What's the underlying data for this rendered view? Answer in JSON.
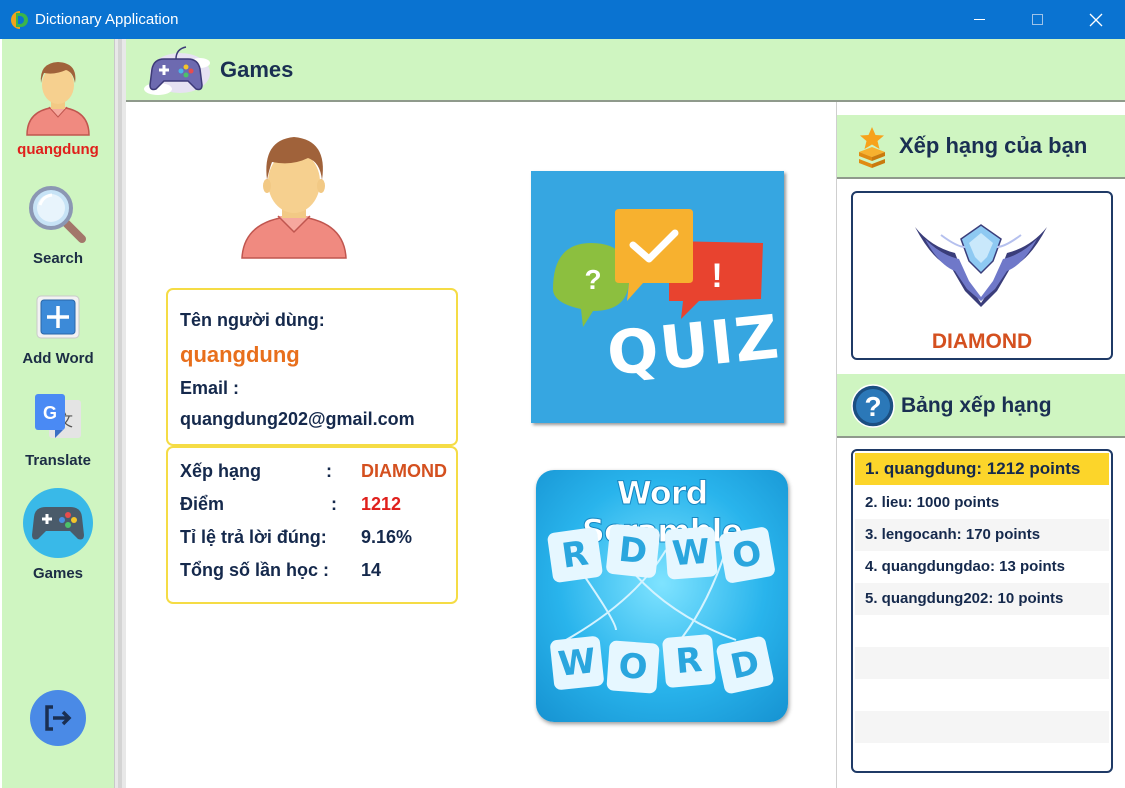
{
  "window": {
    "title": "Dictionary Application"
  },
  "sidebar": {
    "user": {
      "name": "quangdung",
      "icon": "user-avatar-icon"
    },
    "items": [
      {
        "label": "Search",
        "icon": "magnifier-icon"
      },
      {
        "label": "Add Word",
        "icon": "add-icon"
      },
      {
        "label": "Translate",
        "icon": "google-translate-icon"
      },
      {
        "label": "Games",
        "icon": "gamepad-icon"
      }
    ],
    "logout_icon": "logout-icon"
  },
  "header": {
    "title": "Games",
    "icon": "game-controller-icon"
  },
  "profile": {
    "username_label": "Tên người dùng:",
    "username": "quangdung",
    "email_label": "Email :",
    "email": "quangdung202@gmail.com"
  },
  "stats": [
    {
      "label": "Xếp hạng",
      "value": "DIAMOND",
      "color": "#d4501f"
    },
    {
      "label": "Điểm",
      "value": "1212",
      "color": "#e0201c"
    },
    {
      "label": "Tỉ lệ trả lời đúng:",
      "value": "9.16%",
      "color": "#15294c"
    },
    {
      "label": "Tổng số lần học :",
      "value": "14",
      "color": "#15294c"
    }
  ],
  "games": {
    "quiz": {
      "title": "QUIZ"
    },
    "scramble": {
      "title": "Word Scramble",
      "top_letters": [
        "R",
        "D",
        "W",
        "O"
      ],
      "bottom_letters": [
        "W",
        "O",
        "R",
        "D"
      ]
    }
  },
  "your_rank": {
    "title": "Xếp hạng của bạn",
    "rank": "DIAMOND",
    "icon": "diamond-rank-emblem"
  },
  "leaderboard": {
    "title": "Bảng xếp hạng",
    "icon": "question-icon",
    "entries": [
      "1. quangdung: 1212 points",
      "2. lieu: 1000 points",
      "3. lengocanh: 170 points",
      "4. quangdungdao: 13 points",
      "5. quangdung202: 10 points"
    ]
  }
}
